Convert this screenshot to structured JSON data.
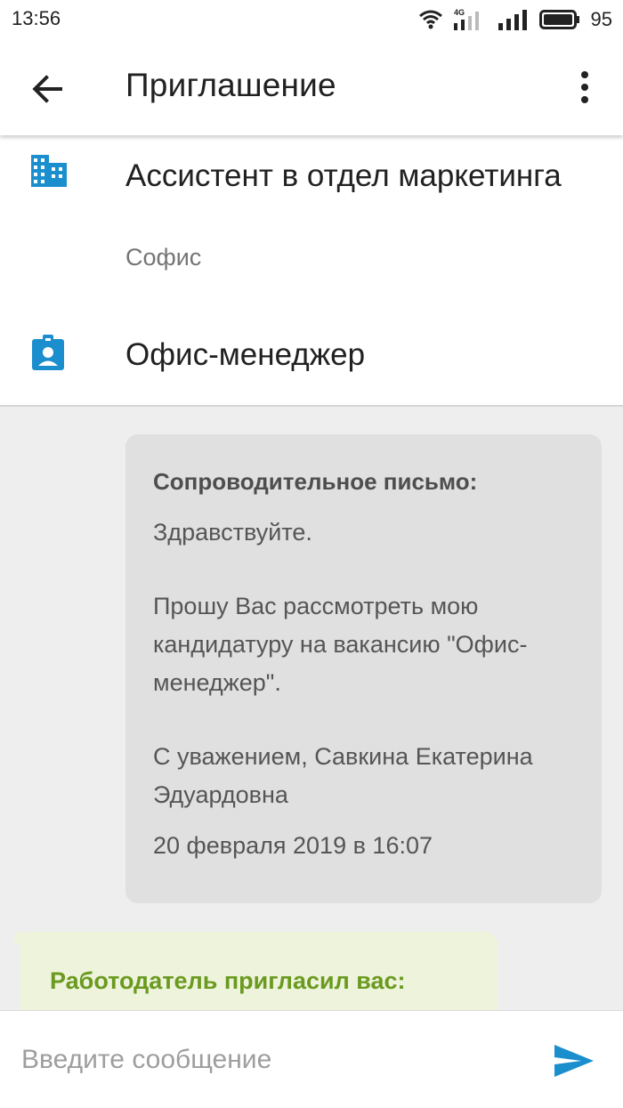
{
  "status_bar": {
    "time": "13:56",
    "network_label": "4G",
    "battery": "95"
  },
  "app_bar": {
    "title": "Приглашение"
  },
  "vacancy": {
    "title": "Ассистент в отдел маркетинга",
    "company": "Софис",
    "resume_title": "Офис-менеджер"
  },
  "messages": {
    "outgoing": {
      "heading": "Сопроводительное письмо:",
      "greeting": "Здравствуйте.",
      "body": "Прошу Вас рассмотреть мою кандидатуру на вакансию \"Офис-менеджер\".",
      "signature": "С уважением, Савкина Екатерина Эдуардовна",
      "date": "20 февраля 2019 в 16:07"
    },
    "incoming": {
      "heading": "Работодатель пригласил вас:"
    }
  },
  "input": {
    "placeholder": "Введите сообщение",
    "value": ""
  },
  "colors": {
    "accent_blue": "#1b8fce",
    "invite_green": "#6a9a1f",
    "outgoing_bubble": "#e0e0e0",
    "incoming_bubble": "#eef3db"
  }
}
